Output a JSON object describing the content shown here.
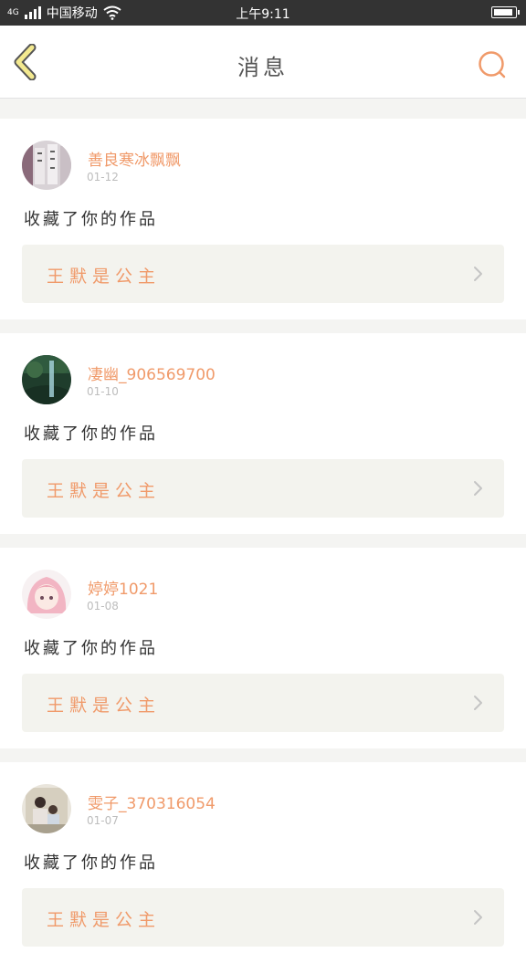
{
  "status_bar": {
    "network": "4G",
    "carrier": "中国移动",
    "time": "上午9:11"
  },
  "header": {
    "title": "消息"
  },
  "colors": {
    "accent": "#f09a6a",
    "back_arrow_fill": "#f3e98f",
    "back_arrow_stroke": "#555555",
    "card_link_bg": "#f3f3ee"
  },
  "notifications": [
    {
      "username": "善良寒冰飘飘",
      "date": "01-12",
      "action": "收藏了你的作品",
      "work_title": "王默是公主",
      "avatar_style": "calligraphy"
    },
    {
      "username": "凄幽_906569700",
      "date": "01-10",
      "action": "收藏了你的作品",
      "work_title": "王默是公主",
      "avatar_style": "forest"
    },
    {
      "username": "婷婷1021",
      "date": "01-08",
      "action": "收藏了你的作品",
      "work_title": "王默是公主",
      "avatar_style": "anime-girl"
    },
    {
      "username": "雯子_370316054",
      "date": "01-07",
      "action": "收藏了你的作品",
      "work_title": "王默是公主",
      "avatar_style": "family-photo"
    }
  ]
}
